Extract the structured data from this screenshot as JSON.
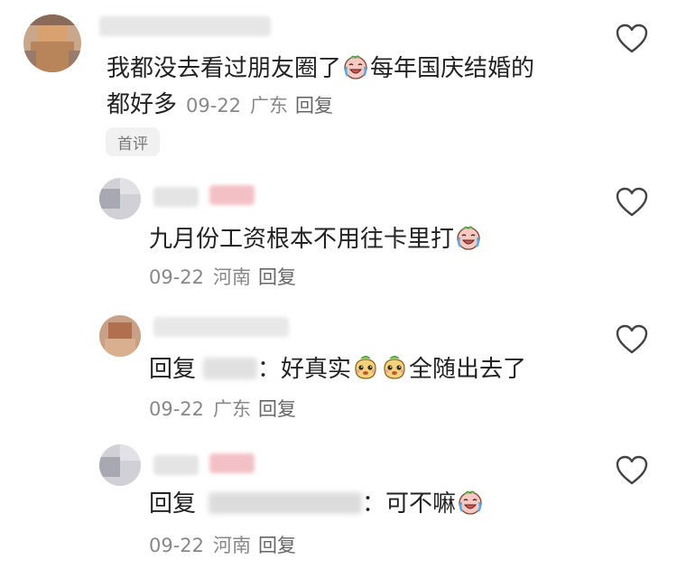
{
  "comments": [
    {
      "line1": "我都没去看过朋友圈了",
      "line1b": "每年国庆结婚的",
      "line2": "都好多",
      "date": "09-22",
      "location": "广东",
      "reply": "回复",
      "badge": "首评",
      "emoji": "crying-laughing-face"
    },
    {
      "text": "九月份工资根本不用往卡里打",
      "date": "09-22",
      "location": "河南",
      "reply": "回复",
      "emoji": "crying-laughing-face"
    },
    {
      "prefix": "回复",
      "colon": "：",
      "text": "好真实",
      "text2": "全随出去了",
      "date": "09-22",
      "location": "广东",
      "reply": "回复",
      "emoji": "money-bag-face"
    },
    {
      "prefix": "回复",
      "colon": "：",
      "text": "可不嘛",
      "date": "09-22",
      "location": "河南",
      "reply": "回复",
      "emoji": "crying-laughing-face"
    }
  ],
  "colors": {
    "text": "#222222",
    "meta": "#888888",
    "heart_stroke": "#444444",
    "badge_bg": "#f1f1f1"
  }
}
